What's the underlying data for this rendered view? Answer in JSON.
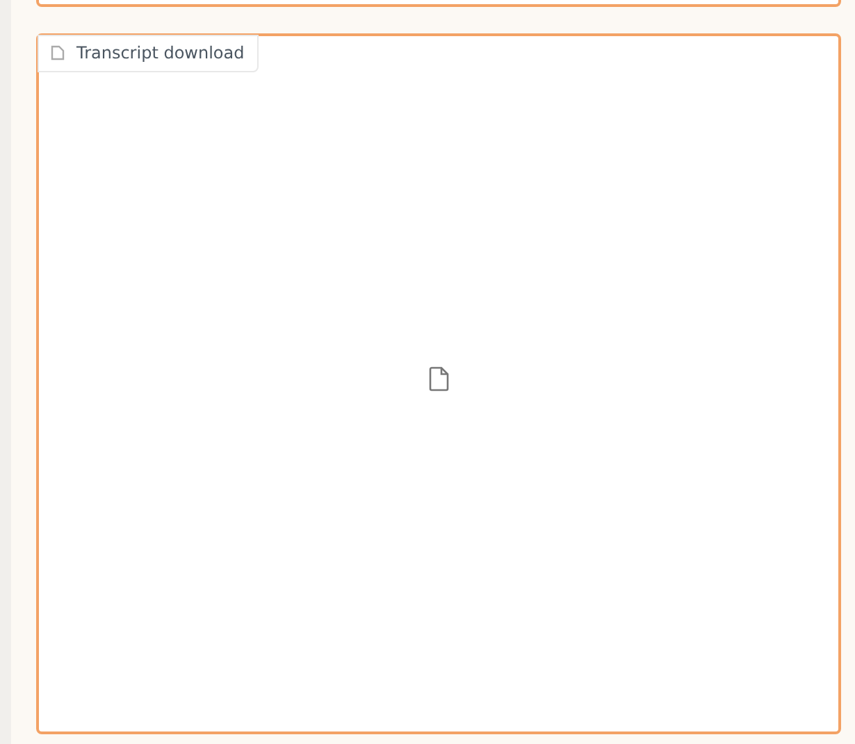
{
  "file_panel": {
    "label": "Transcript download"
  }
}
